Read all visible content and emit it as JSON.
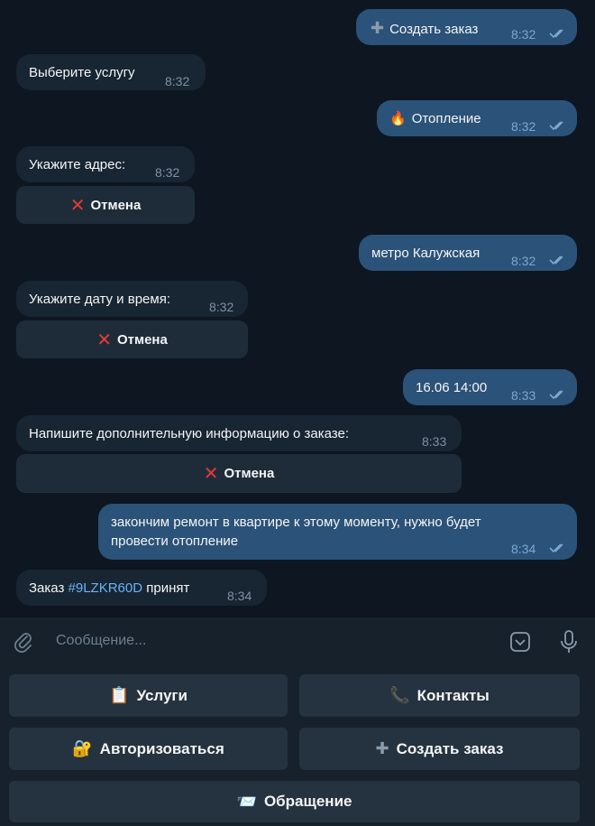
{
  "messages": [
    {
      "dir": "out",
      "text": "Создать заказ",
      "icon": "plus-icon",
      "time": "8:32"
    },
    {
      "dir": "in",
      "text": "Выберите услугу",
      "time": "8:32"
    },
    {
      "dir": "out",
      "text": "Отопление",
      "icon": "fire-icon",
      "time": "8:32"
    },
    {
      "dir": "in",
      "text": "Укажите адрес:",
      "time": "8:32",
      "button": "Отмена"
    },
    {
      "dir": "out",
      "text": "метро Калужская",
      "time": "8:32"
    },
    {
      "dir": "in",
      "text": "Укажите дату и время:",
      "time": "8:32",
      "button": "Отмена"
    },
    {
      "dir": "out",
      "text": "16.06 14:00",
      "time": "8:33"
    },
    {
      "dir": "in",
      "text": "Напишите дополнительную информацию о заказе:",
      "time": "8:33",
      "button": "Отмена"
    },
    {
      "dir": "out",
      "line1": "закончим ремонт в квартире к этому моменту, нужно будет",
      "line2": "провести отопление",
      "time": "8:34"
    },
    {
      "dir": "in",
      "prefix": "Заказ ",
      "link": "#9LZKR60D",
      "suffix": " принят",
      "time": "8:34"
    }
  ],
  "composer": {
    "placeholder": "Сообщение..."
  },
  "keyboard": [
    {
      "label": "Услуги",
      "icon": "clipboard-icon"
    },
    {
      "label": "Контакты",
      "icon": "phone-icon"
    },
    {
      "label": "Авторизоваться",
      "icon": "lock-key-icon"
    },
    {
      "label": "Создать заказ",
      "icon": "plus-icon"
    },
    {
      "label": "Обращение",
      "icon": "envelope-icon"
    }
  ],
  "colors": {
    "background": "#0e1621",
    "outgoing": "#2b5278",
    "incoming": "#182533",
    "link": "#6ab3f3",
    "cancel": "#e53935"
  }
}
